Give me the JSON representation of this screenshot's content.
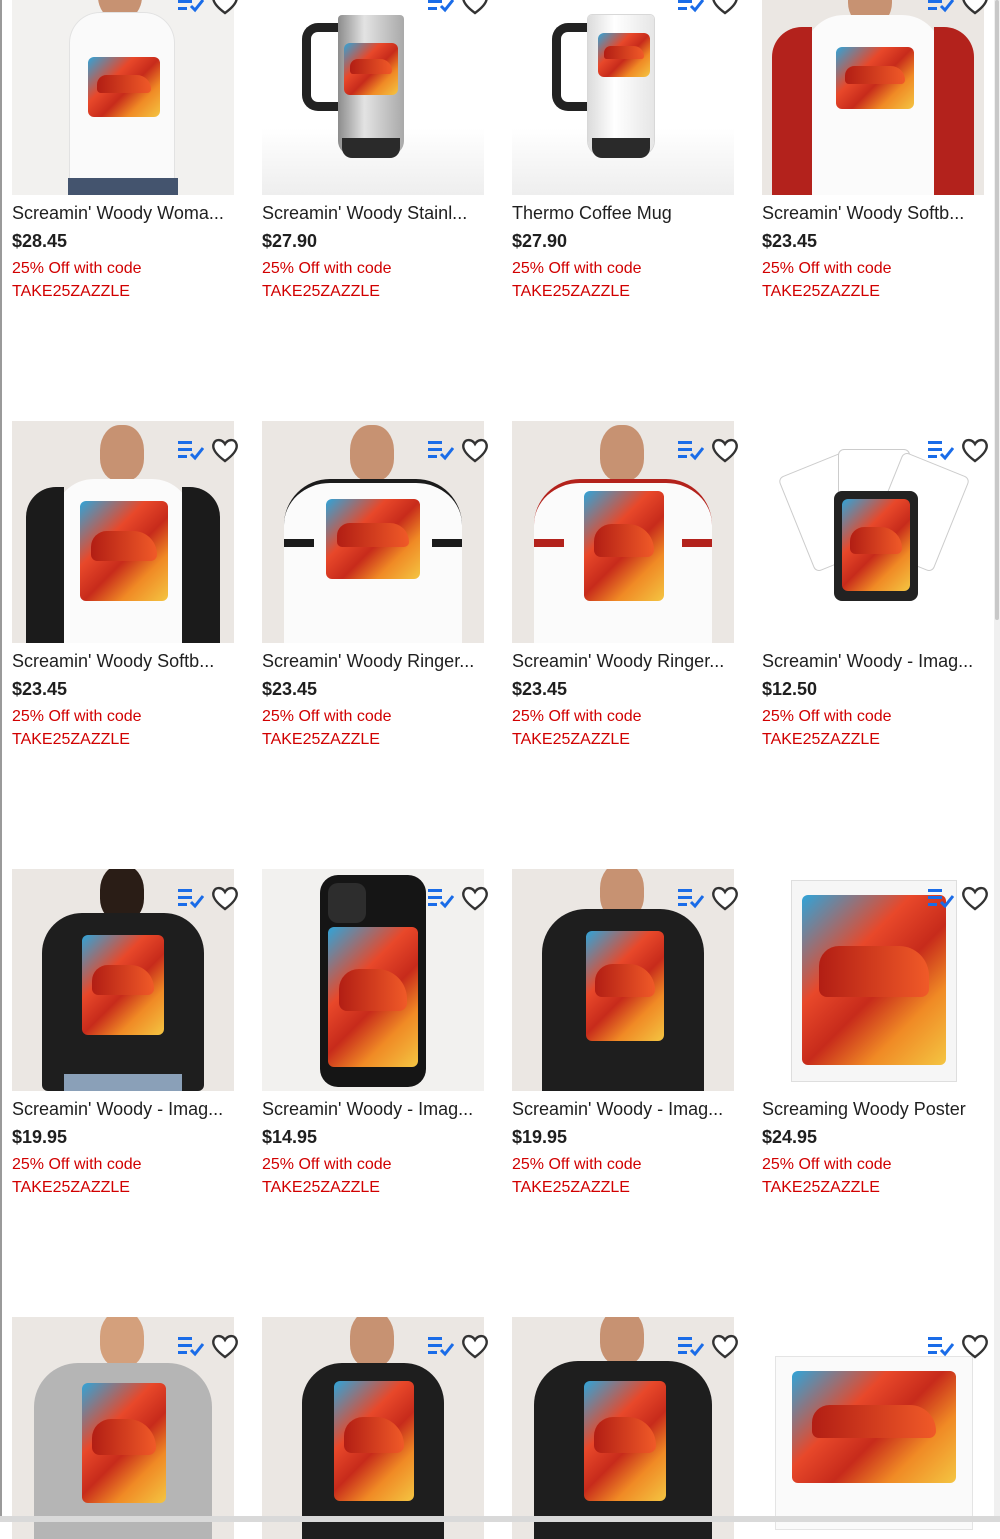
{
  "promo": {
    "line1": "25% Off with code",
    "line2": "TAKE25ZAZZLE"
  },
  "colors": {
    "promo": "#d10000",
    "compare_icon": "#1a6ce8",
    "text": "#1f1f1f"
  },
  "products": [
    {
      "title": "Screamin' Woody Woma...",
      "price": "$28.45",
      "image": "womens-white-tank-top"
    },
    {
      "title": "Screamin' Woody Stainl...",
      "price": "$27.90",
      "image": "stainless-travel-mug"
    },
    {
      "title": "Thermo Coffee Mug",
      "price": "$27.90",
      "image": "white-thermo-mug"
    },
    {
      "title": "Screamin' Woody Softb...",
      "price": "$23.45",
      "image": "red-raglan-shirt"
    },
    {
      "title": "Screamin' Woody Softb...",
      "price": "$23.45",
      "image": "black-raglan-shirt"
    },
    {
      "title": "Screamin' Woody Ringer...",
      "price": "$23.45",
      "image": "black-ringer-tee"
    },
    {
      "title": "Screamin' Woody Ringer...",
      "price": "$23.45",
      "image": "red-ringer-tee"
    },
    {
      "title": "Screamin' Woody - Imag...",
      "price": "$12.50",
      "image": "playing-cards"
    },
    {
      "title": "Screamin' Woody - Imag...",
      "price": "$19.95",
      "image": "womens-black-tee"
    },
    {
      "title": "Screamin' Woody - Imag...",
      "price": "$14.95",
      "image": "black-phone-case"
    },
    {
      "title": "Screamin' Woody - Imag...",
      "price": "$19.95",
      "image": "mens-black-tee"
    },
    {
      "title": "Screaming Woody Poster",
      "price": "$24.95",
      "image": "poster"
    },
    {
      "title": "",
      "price": "",
      "image": "kids-grey-tee"
    },
    {
      "title": "",
      "price": "",
      "image": "womens-black-tee-front"
    },
    {
      "title": "",
      "price": "",
      "image": "mens-black-tee-front"
    },
    {
      "title": "",
      "price": "",
      "image": "sticker"
    }
  ]
}
